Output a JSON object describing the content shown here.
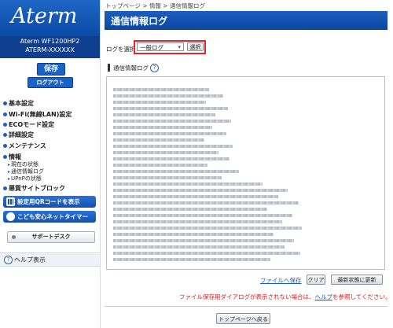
{
  "sidebar": {
    "logo": "Aterm",
    "model_line1": "Aterm WF1200HP2",
    "model_line2": "ATERM-XXXXXX",
    "save_label": "保存",
    "logout_label": "ログアウト",
    "menu": {
      "basic": "基本設定",
      "wifi": "Wi-Fi(無線LAN)設定",
      "eco": "ECOモード設定",
      "detail": "詳細設定",
      "maintenance": "メンテナンス",
      "info": "情報",
      "info_status": "現在の状態",
      "info_log": "通信情報ログ",
      "info_upnp": "UPnPの状態",
      "malicious": "悪質サイトブロック"
    },
    "qr_button": "設定用QRコードを表示",
    "kids_button": "こども安心ネットタイマー",
    "support_button": "サポートデスク",
    "help_label": "ヘルプ表示"
  },
  "main": {
    "breadcrumb": "トップページ > 情報 > 通信情報ログ",
    "title": "通信情報ログ",
    "select_label": "ログを選択",
    "select_value": "一般ログ",
    "select_button": "選択",
    "log_heading": "通信情報ログ",
    "help_q": "?",
    "save_file_link": "ファイルへ保存",
    "clear_button": "クリア",
    "refresh_button": "最新状態に更新",
    "warning_prefix": "ファイル保存用ダイアログが表示されない場合は、",
    "warning_link": "ヘルプ",
    "warning_suffix": "を参照してください。",
    "back_button": "トップページへ戻る"
  },
  "colors": {
    "brand_blue": "#0b4aa6",
    "highlight_red": "#e3262b",
    "warning_red": "#d0201f",
    "link_blue": "#1a56c9"
  }
}
